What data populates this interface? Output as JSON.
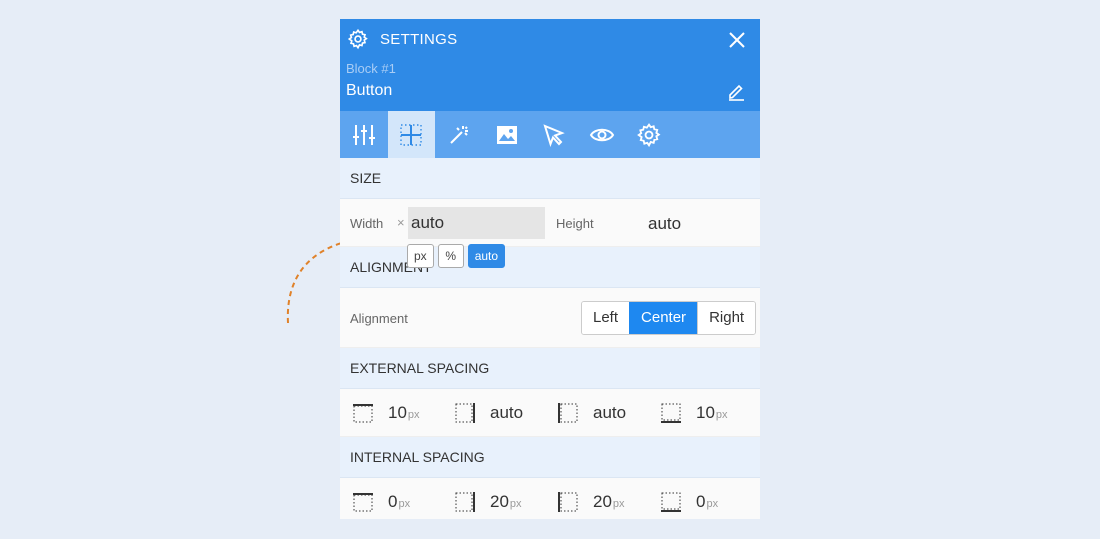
{
  "header": {
    "title": "SETTINGS",
    "subtitle": "Block #1",
    "name": "Button"
  },
  "tabs": [
    {
      "icon": "sliders-icon"
    },
    {
      "icon": "grid-layout-icon"
    },
    {
      "icon": "magic-wand-icon"
    },
    {
      "icon": "image-icon"
    },
    {
      "icon": "cursor-icon"
    },
    {
      "icon": "eye-icon"
    },
    {
      "icon": "gear-icon"
    }
  ],
  "size": {
    "section_label": "SIZE",
    "width_label": "Width",
    "width_clear": "×",
    "width_value": "auto",
    "height_label": "Height",
    "height_value": "auto",
    "units": [
      "px",
      "%",
      "auto"
    ],
    "selected_unit": "auto"
  },
  "alignment": {
    "section_label": "ALIGNMENT",
    "label": "Alignment",
    "options": [
      "Left",
      "Center",
      "Right"
    ],
    "selected": "Center"
  },
  "external_spacing": {
    "section_label": "EXTERNAL SPACING",
    "items": [
      {
        "side": "top",
        "value": "10",
        "unit": "px"
      },
      {
        "side": "right",
        "value": "auto",
        "unit": ""
      },
      {
        "side": "left",
        "value": "auto",
        "unit": ""
      },
      {
        "side": "bottom",
        "value": "10",
        "unit": "px"
      }
    ]
  },
  "internal_spacing": {
    "section_label": "INTERNAL SPACING",
    "items": [
      {
        "side": "top",
        "value": "0",
        "unit": "px"
      },
      {
        "side": "right",
        "value": "20",
        "unit": "px"
      },
      {
        "side": "left",
        "value": "20",
        "unit": "px"
      },
      {
        "side": "bottom",
        "value": "0",
        "unit": "px"
      }
    ]
  },
  "colors": {
    "header_bg": "#2f8ae6",
    "tabs_bg": "#5da4ef",
    "accent": "#1e88f0",
    "hint_arrow": "#e0822a"
  }
}
